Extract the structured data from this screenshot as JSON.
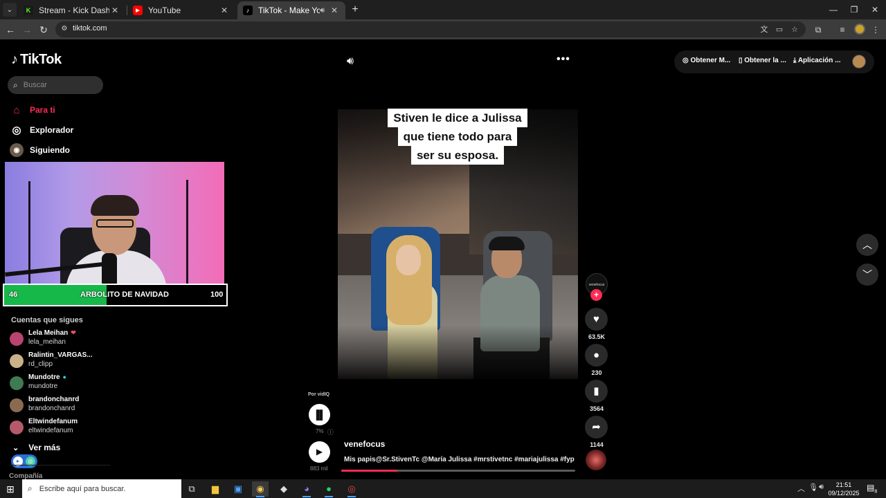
{
  "browser": {
    "tabs": [
      {
        "title": "Stream - Kick Dashboard",
        "favicon": "K",
        "favicon_color": "#53fc18",
        "active": false
      },
      {
        "title": "YouTube",
        "favicon": "▶",
        "favicon_color": "#ff0000",
        "active": false
      },
      {
        "title": "TikTok - Make Your Day",
        "favicon": "♪",
        "favicon_color": "#000000",
        "active": true
      }
    ],
    "url": "tiktok.com"
  },
  "tiktok": {
    "logo": "TikTok",
    "search_placeholder": "Buscar",
    "nav": [
      {
        "label": "Para ti",
        "icon": "home-icon",
        "active": true
      },
      {
        "label": "Explorador",
        "icon": "compass-icon",
        "active": false
      },
      {
        "label": "Siguiendo",
        "icon": "avatar-icon",
        "active": false
      }
    ],
    "goal": {
      "current": "46",
      "label": "ARBOLITO DE NAVIDAD",
      "target": "100",
      "progress": 0.46
    },
    "following_title": "Cuentas que sigues",
    "accounts": [
      {
        "name": "Lela Meihan",
        "handle": "lela_meihan",
        "badge": "❤",
        "badge_color": "#ff4d6d",
        "avatar_color": "#b8446f"
      },
      {
        "name": "Ralintin_VARGAS...",
        "handle": "rd_clipp",
        "badge": "",
        "badge_color": "",
        "avatar_color": "#c9b28a"
      },
      {
        "name": "Mundotre",
        "handle": "mundotre",
        "badge": "●",
        "badge_color": "#20d5ec",
        "avatar_color": "#3f7a52"
      },
      {
        "name": "brandonchanrd",
        "handle": "brandonchanrd",
        "badge": "",
        "badge_color": "",
        "avatar_color": "#8a6b52"
      },
      {
        "name": "Eltwindefanum",
        "handle": "eltwindefanum",
        "badge": "",
        "badge_color": "",
        "avatar_color": "#b45a6a"
      }
    ],
    "see_more": "Ver más",
    "company": "Compañía",
    "top_actions": [
      "Obtener M...",
      "Obtener la ...",
      "Aplicación ..."
    ],
    "video_caption": [
      "Stiven le dice a Julissa",
      "que tiene todo para",
      "ser su esposa."
    ],
    "author_avatar_text": "venefocus",
    "likes": "63.5K",
    "comments": "230",
    "saves": "3564",
    "shares": "1144",
    "vidiq_label": "Por vidIQ",
    "vidiq_score": "7%",
    "views": "883 mil",
    "author": "venefocus",
    "description": "Mis papis@Sr.StivenTc @María Julissa #mrstivetnc #mariajulissa #fyp",
    "progress": 0.24
  },
  "taskbar": {
    "search_placeholder": "Escribe aquí para buscar.",
    "time": "21:51",
    "date": "09/12/2025",
    "notifications": "8"
  }
}
